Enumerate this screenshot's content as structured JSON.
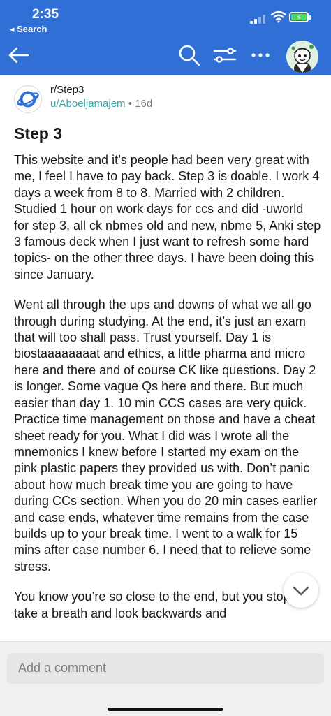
{
  "status_bar": {
    "time": "2:35",
    "back_app": "◂ Search"
  },
  "nav": {
    "back_icon": "arrow-left-icon",
    "search_icon": "search-icon",
    "sort_icon": "sort-filter-icon",
    "more_icon": "more-dots-icon",
    "avatar_icon": "user-avatar-icon"
  },
  "post": {
    "subreddit": "r/Step3",
    "author": "u/Aboeljamajem",
    "separator": "•",
    "age": "16d",
    "title": "Step 3",
    "paragraphs": [
      "This website and it’s people had been very great with me, I feel I have to pay back. Step 3 is doable. I work 4 days a week from 8 to 8. Married with 2 children. Studied 1 hour on work days for ccs and did -uworld for step 3, all ck nbmes old and new, nbme 5, Anki step 3 famous deck when I just want to refresh some hard topics- on the other three days. I have been doing this since January.",
      "Went all through the ups and downs of what we all go through during studying. At the end, it’s just an exam that will too shall pass. Trust yourself. Day 1 is biostaaaaaaaat and ethics, a little pharma and micro here and there and of course CK like questions. Day 2 is longer. Some vague Qs here and there. But much easier than day 1. 10 min CCS cases are very quick. Practice time management on those and have a cheat sheet ready for you. What I did was I wrote all the mnemonics I knew before I started my exam on the pink plastic papers they provided us with. Don’t panic about how much break time you are going to have during CCs section. When you do 20 min cases earlier and case ends, whatever time remains from the case builds up to your break time. I went to a walk for 15 mins after case number 6. I need that to relieve some stress.",
      "You know you’re so close to the end, but you stop to take a breath and look backwards and"
    ]
  },
  "comment": {
    "placeholder": "Add a comment"
  },
  "colors": {
    "header_bg": "#2f6fd6",
    "username": "#3aa4a4",
    "battery_green": "#4cd964"
  }
}
